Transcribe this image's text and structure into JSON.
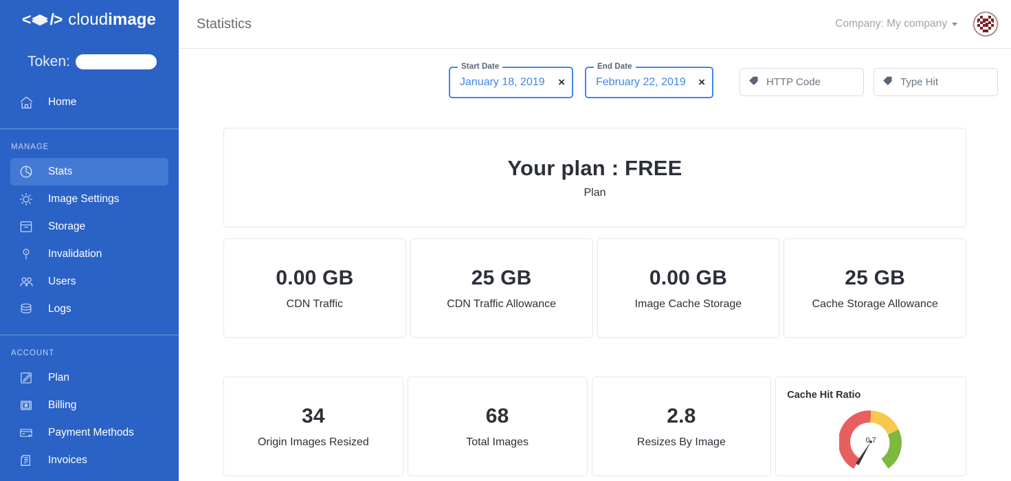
{
  "brand": {
    "logo_cloud": "cloud",
    "logo_image": "image",
    "sidebar_color": "#2a62c6",
    "active_item_color": "#447ad4",
    "accent_blue": "#3f86e8"
  },
  "sidebar": {
    "token_label": "Token:",
    "home_label": "Home",
    "sections": [
      {
        "title": "MANAGE",
        "items": [
          {
            "label": "Stats",
            "icon": "pie-chart-icon",
            "active": true
          },
          {
            "label": "Image Settings",
            "icon": "gear-icon",
            "active": false
          },
          {
            "label": "Storage",
            "icon": "box-icon",
            "active": false
          },
          {
            "label": "Invalidation",
            "icon": "key-icon",
            "active": false
          },
          {
            "label": "Users",
            "icon": "users-icon",
            "active": false
          },
          {
            "label": "Logs",
            "icon": "database-icon",
            "active": false
          }
        ]
      },
      {
        "title": "ACCOUNT",
        "items": [
          {
            "label": "Plan",
            "icon": "edit-square-icon",
            "active": false
          },
          {
            "label": "Billing",
            "icon": "billing-icon",
            "active": false
          },
          {
            "label": "Payment Methods",
            "icon": "credit-card-icon",
            "active": false
          },
          {
            "label": "Invoices",
            "icon": "invoice-icon",
            "active": false
          }
        ]
      }
    ]
  },
  "topbar": {
    "title": "Statistics",
    "company_label": "Company:",
    "company_value": "My company"
  },
  "filters": {
    "start_date": {
      "label": "Start Date",
      "value": "January 18, 2019",
      "clear": "×"
    },
    "end_date": {
      "label": "End Date",
      "value": "February 22, 2019",
      "clear": "×"
    },
    "http_code": {
      "placeholder": "HTTP Code",
      "value": ""
    },
    "type_hit": {
      "placeholder": "Type Hit",
      "value": ""
    }
  },
  "plan_card": {
    "title": "Your plan : FREE",
    "subtitle": "Plan"
  },
  "stats_row_1": [
    {
      "value": "0.00 GB",
      "label": "CDN Traffic"
    },
    {
      "value": "25 GB",
      "label": "CDN Traffic Allowance"
    },
    {
      "value": "0.00 GB",
      "label": "Image Cache Storage"
    },
    {
      "value": "25 GB",
      "label": "Cache Storage Allowance"
    }
  ],
  "stats_row_2": [
    {
      "value": "34",
      "label": "Origin Images Resized"
    },
    {
      "value": "68",
      "label": "Total Images"
    },
    {
      "value": "2.8",
      "label": "Resizes By Image"
    }
  ],
  "chart_data": {
    "type": "gauge",
    "title": "Cache Hit Ratio",
    "value": 0.7,
    "value_label": "0.7",
    "min": 0,
    "max": 1,
    "needle_value": 0.02,
    "bands": [
      {
        "name": "low",
        "from": 0.0,
        "to": 0.45,
        "color": "#e85f60"
      },
      {
        "name": "medium",
        "from": 0.45,
        "to": 0.72,
        "color": "#f6c84b"
      },
      {
        "name": "high",
        "from": 0.72,
        "to": 1.0,
        "color": "#7db83f"
      }
    ]
  }
}
